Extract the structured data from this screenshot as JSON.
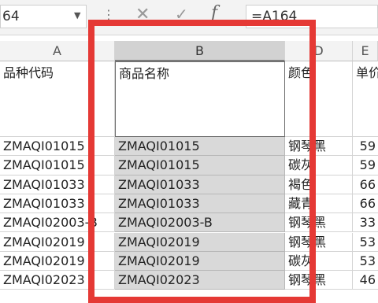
{
  "formula_bar": {
    "name_box": "64",
    "dots": "⋮",
    "cancel": "✕",
    "enter": "✓",
    "fx": "f",
    "formula": "=A164"
  },
  "columns": [
    {
      "letter": "A",
      "header": "品种代码"
    },
    {
      "letter": "B",
      "header": "商品名称"
    },
    {
      "letter": "D",
      "header": "颜色"
    },
    {
      "letter": "E",
      "header": "单价"
    }
  ],
  "rows": [
    {
      "a": "ZMAQI01015",
      "b": "ZMAQI01015",
      "d": "钢琴黑",
      "e": "59"
    },
    {
      "a": "ZMAQI01015",
      "b": "ZMAQI01015",
      "d": "碳灰",
      "e": "59"
    },
    {
      "a": "ZMAQI01033",
      "b": "ZMAQI01033",
      "d": "褐色",
      "e": "66"
    },
    {
      "a": "ZMAQI01033",
      "b": "ZMAQI01033",
      "d": "藏青",
      "e": "66"
    },
    {
      "a": "ZMAQI02003-B",
      "b": "ZMAQI02003-B",
      "d": "钢琴黑",
      "e": "33"
    },
    {
      "a": "ZMAQI02019",
      "b": "ZMAQI02019",
      "d": "钢琴黑",
      "e": "53"
    },
    {
      "a": "ZMAQI02019",
      "b": "ZMAQI02019",
      "d": "碳灰",
      "e": "53"
    },
    {
      "a": "ZMAQI02023",
      "b": "ZMAQI02023",
      "d": "钢琴黑",
      "e": "46"
    }
  ],
  "colors": {
    "highlight_frame": "#e53935",
    "selected_fill": "#d9d9d9"
  }
}
